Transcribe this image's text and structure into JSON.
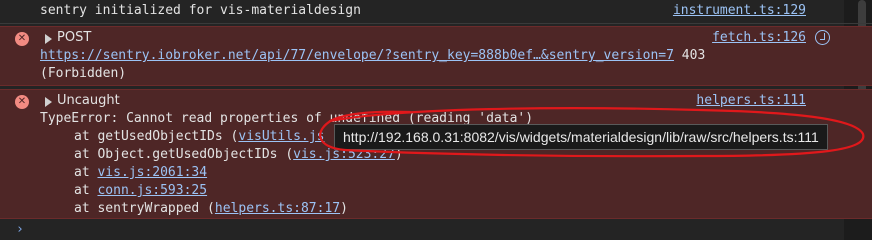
{
  "console": {
    "info": {
      "message": "sentry initialized for vis-materialdesign",
      "source": "instrument.ts:129"
    },
    "post_error": {
      "title": "POST",
      "source": "fetch.ts:126",
      "url": "https://sentry.iobroker.net/api/77/envelope/?sentry_key=888b0ef…&sentry_version=7",
      "status": "403",
      "status_text": "(Forbidden)",
      "icon": "network-icon"
    },
    "uncaught_error": {
      "title": "Uncaught",
      "source": "helpers.ts:111",
      "message": "TypeError: Cannot read properties of undefined (reading 'data')",
      "stack": [
        {
          "prefix": "at getUsedObjectIDs (",
          "link": "visUtils.js",
          "suffix": ""
        },
        {
          "prefix": "at Object.getUsedObjectIDs (",
          "link": "vis.js:523:27",
          "suffix": ")"
        },
        {
          "prefix": "at ",
          "link": "vis.js:2061:34",
          "suffix": ""
        },
        {
          "prefix": "at ",
          "link": "conn.js:593:25",
          "suffix": ""
        },
        {
          "prefix": "at sentryWrapped (",
          "link": "helpers.ts:87:17",
          "suffix": ")"
        }
      ]
    },
    "tooltip": "http://192.168.0.31:8082/vis/widgets/materialdesign/lib/raw/src/helpers.ts:111",
    "prompt": "›"
  },
  "colors": {
    "error_bg": "#4e2626",
    "link": "#9cc3f5",
    "annotation": "#e0181b"
  }
}
